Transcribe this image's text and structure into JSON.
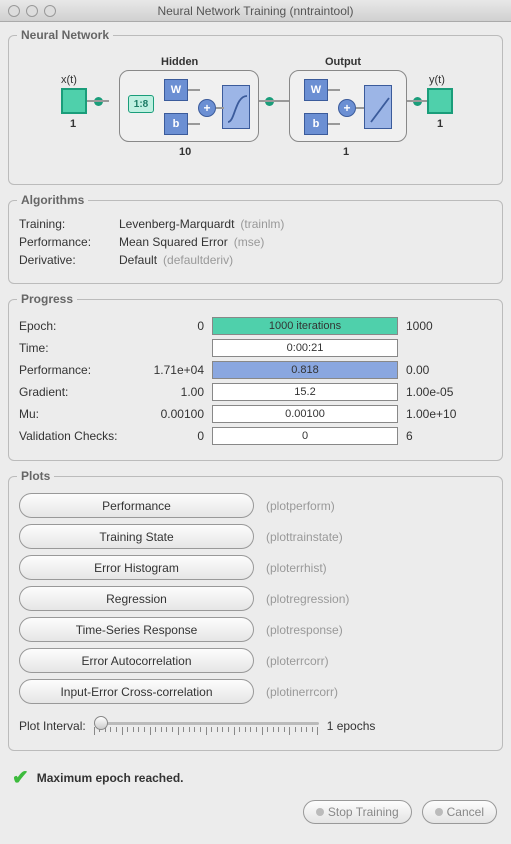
{
  "window": {
    "title": "Neural Network Training (nntraintool)"
  },
  "sections": {
    "network": "Neural Network",
    "algorithms": "Algorithms",
    "progress": "Progress",
    "plots": "Plots"
  },
  "diagram": {
    "input_label": "x(t)",
    "input_dim": "1",
    "hidden_label": "Hidden",
    "hidden_count": "10",
    "output_label": "Output",
    "output_count": "1",
    "out_label": "y(t)",
    "out_dim": "1",
    "delay": "1:8",
    "w": "W",
    "b": "b",
    "plus": "+"
  },
  "algorithms": [
    {
      "label": "Training:",
      "value": "Levenberg-Marquardt",
      "hint": "(trainlm)"
    },
    {
      "label": "Performance:",
      "value": "Mean Squared Error",
      "hint": "(mse)"
    },
    {
      "label": "Derivative:",
      "value": "Default",
      "hint": "(defaultderiv)"
    }
  ],
  "progress": [
    {
      "label": "Epoch:",
      "start": "0",
      "bar": "1000 iterations",
      "end": "1000",
      "fill": "green",
      "pct": 100
    },
    {
      "label": "Time:",
      "start": "",
      "bar": "0:00:21",
      "end": "",
      "fill": "",
      "pct": 0
    },
    {
      "label": "Performance:",
      "start": "1.71e+04",
      "bar": "0.818",
      "end": "0.00",
      "fill": "blue",
      "pct": 100
    },
    {
      "label": "Gradient:",
      "start": "1.00",
      "bar": "15.2",
      "end": "1.00e-05",
      "fill": "",
      "pct": 0
    },
    {
      "label": "Mu:",
      "start": "0.00100",
      "bar": "0.00100",
      "end": "1.00e+10",
      "fill": "",
      "pct": 0
    },
    {
      "label": "Validation Checks:",
      "start": "0",
      "bar": "0",
      "end": "6",
      "fill": "",
      "pct": 0
    }
  ],
  "plots": [
    {
      "label": "Performance",
      "hint": "(plotperform)"
    },
    {
      "label": "Training State",
      "hint": "(plottrainstate)"
    },
    {
      "label": "Error Histogram",
      "hint": "(ploterrhist)"
    },
    {
      "label": "Regression",
      "hint": "(plotregression)"
    },
    {
      "label": "Time-Series Response",
      "hint": "(plotresponse)"
    },
    {
      "label": "Error Autocorrelation",
      "hint": "(ploterrcorr)"
    },
    {
      "label": "Input-Error Cross-correlation",
      "hint": "(plotinerrcorr)"
    }
  ],
  "plot_interval": {
    "label": "Plot Interval:",
    "value": "1 epochs"
  },
  "status": "Maximum epoch reached.",
  "buttons": {
    "stop": "Stop Training",
    "cancel": "Cancel"
  }
}
